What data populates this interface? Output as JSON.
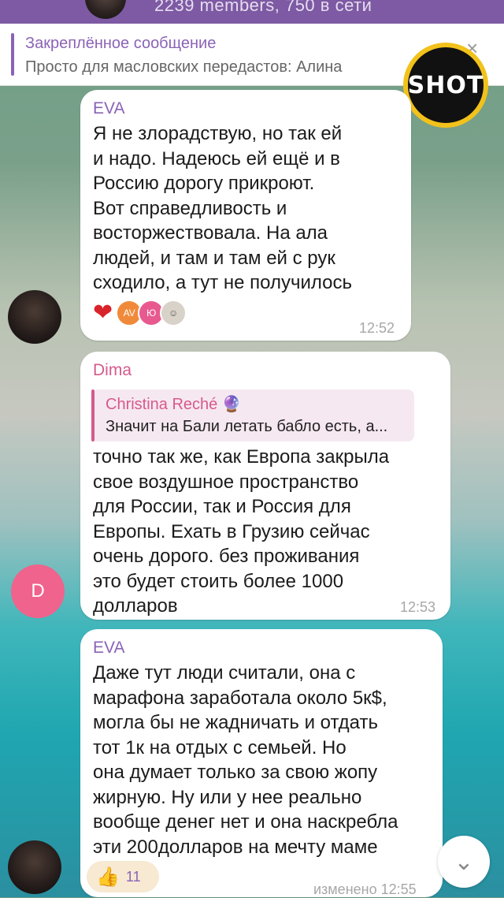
{
  "header": {
    "members": "2239 members, 750 в сети"
  },
  "pinned": {
    "title": "Закреплённое сообщение",
    "text": "Просто для масловских передастов: Алина",
    "close": "×"
  },
  "watermark": {
    "logo_text": "SHOT"
  },
  "messages": [
    {
      "sender": "EVA",
      "text": "Я не злорадствую, но так ей\nи надо. Надеюсь ей ещё и в\nРоссию дорогу прикроют.\nВот справедливость и\nвосторжествовала. На      ала\nлюдей, и там и там ей с рук\nсходило, а тут не получилось",
      "time": "12:52",
      "reactions": {
        "heart": "❤",
        "avatars": [
          "AV",
          "Ю",
          "☺"
        ]
      }
    },
    {
      "sender": "Dima",
      "avatar_letter": "D",
      "reply": {
        "name": "Christina Reché 🔮",
        "text": "Значит на Бали летать бабло есть, а..."
      },
      "text": "точно так же, как Европа закрыла\nсвое воздушное пространство\nдля России, так и Россия для\nЕвропы.  Ехать в Грузию сейчас\nочень дорого.  без проживания\nэто будет стоить более 1000\nдолларов",
      "time": "12:53"
    },
    {
      "sender": "EVA",
      "text": "Даже тут люди считали, она с\nмарафона заработала около 5к$,\nмогла бы не жадничать и отдать\nтот 1к на отдых с семьей. Но\nона думает только за свою жопу\nжирную. Ну или у нее реально\nвообще денег нет и она наскребла\nэти 200долларов на мечту маме",
      "reaction": {
        "emoji": "👍",
        "count": "11"
      },
      "edited": "изменено 12:55"
    }
  ],
  "scroll_down": "⌄",
  "colors": {
    "accent": "#8a63b6",
    "header": "#7d5aa3",
    "reply_accent": "#d65a8b",
    "heart": "#d9232b"
  }
}
